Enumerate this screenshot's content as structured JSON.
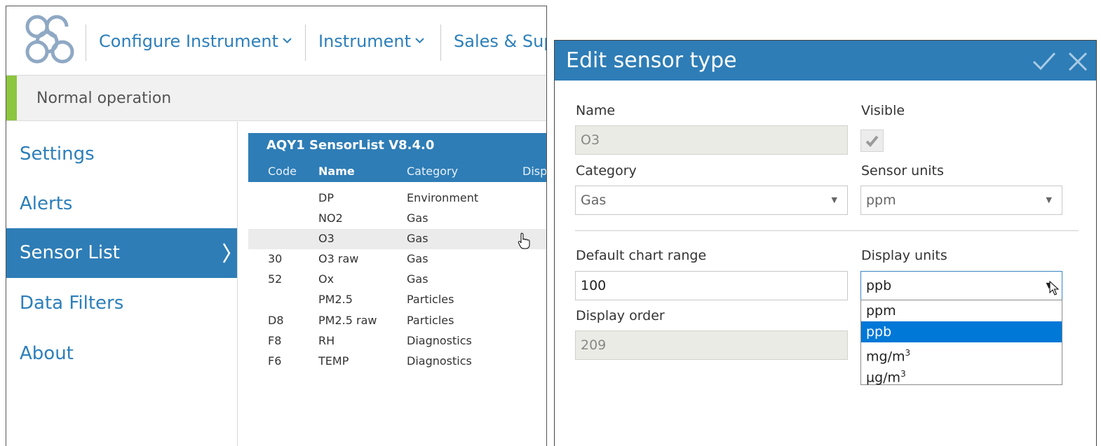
{
  "nav": {
    "items": [
      {
        "label": "Configure Instrument",
        "chevron": "⌄"
      },
      {
        "label": "Instrument",
        "chevron": "⌄"
      },
      {
        "label": "Sales & Sup"
      }
    ]
  },
  "status": {
    "text": "Normal operation",
    "color": "#8cc63f"
  },
  "sidebar": {
    "items": [
      {
        "label": "Settings"
      },
      {
        "label": "Alerts"
      },
      {
        "label": "Sensor List",
        "arrow": "〉"
      },
      {
        "label": "Data Filters"
      },
      {
        "label": "About"
      }
    ]
  },
  "sensor_list": {
    "title": "AQY1 SensorList V8.4.0",
    "columns": [
      "Code",
      "Name",
      "Category",
      "Disp"
    ],
    "rows": [
      {
        "code": "",
        "name": "DP",
        "category": "Environment"
      },
      {
        "code": "",
        "name": "NO2",
        "category": "Gas"
      },
      {
        "code": "",
        "name": "O3",
        "category": "Gas"
      },
      {
        "code": "30",
        "name": "O3 raw",
        "category": "Gas"
      },
      {
        "code": "52",
        "name": "Ox",
        "category": "Gas"
      },
      {
        "code": "",
        "name": "PM2.5",
        "category": "Particles"
      },
      {
        "code": "D8",
        "name": "PM2.5 raw",
        "category": "Particles"
      },
      {
        "code": "F8",
        "name": "RH",
        "category": "Diagnostics"
      },
      {
        "code": "F6",
        "name": "TEMP",
        "category": "Diagnostics"
      }
    ]
  },
  "dialog": {
    "title": "Edit sensor type",
    "name_label": "Name",
    "name_value": "O3",
    "visible_label": "Visible",
    "category_label": "Category",
    "category_value": "Gas",
    "sensor_units_label": "Sensor units",
    "sensor_units_value": "ppm",
    "chart_range_label": "Default chart range",
    "chart_range_value": "100",
    "display_units_label": "Display units",
    "display_units_value": "ppb",
    "display_order_label": "Display order",
    "display_order_value": "209",
    "display_units_options": [
      {
        "text": "ppm",
        "sup": ""
      },
      {
        "text": "ppb",
        "sup": ""
      },
      {
        "text": "mg/m",
        "sup": "3"
      },
      {
        "text": "µg/m",
        "sup": "3"
      }
    ]
  },
  "colors": {
    "accent": "#2e7db6",
    "link": "#2c7fba",
    "selection": "#0078d7"
  }
}
